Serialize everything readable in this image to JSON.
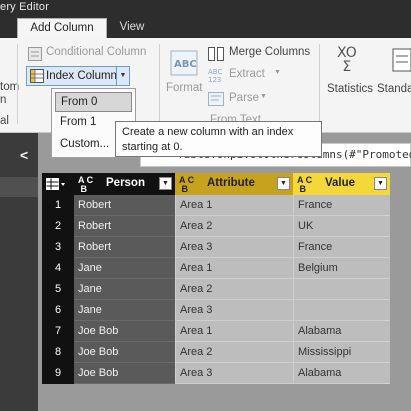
{
  "window": {
    "title": "ery Editor"
  },
  "tabs": [
    {
      "label": "Add Column",
      "active": true
    },
    {
      "label": "View",
      "active": false
    }
  ],
  "ribbon": {
    "custom_label_1": "tom",
    "custom_label_2": "n",
    "general_group": "al",
    "conditional_column": "Conditional Column",
    "index_column": "Index Column",
    "index_column_arrow": "▼",
    "format": "Format",
    "merge_columns": "Merge Columns",
    "extract": "Extract",
    "parse": "Parse",
    "from_text_group": "From Text",
    "statistics": "Statistics",
    "standard": "Standa",
    "sigma_glyph": "XO\nΣ"
  },
  "dropdown": {
    "items": [
      "From 0",
      "From 1",
      "Custom..."
    ],
    "hovered_index": 0
  },
  "tooltip": {
    "text": "Create a new column with an index starting at 0."
  },
  "formula_bar": {
    "text": "Table.Unpivot0therColumns(#\"Promoted"
  },
  "left_panel": {
    "chevron": "<"
  },
  "table": {
    "type_glyph": "A C\n B",
    "columns": [
      {
        "label": "Person",
        "type": "ABC",
        "header_bg": "#111111",
        "header_fg": "#ffffff"
      },
      {
        "label": "Attribute",
        "type": "ABC",
        "header_bg": "#c7a21e",
        "header_fg": "#222222"
      },
      {
        "label": "Value",
        "type": "ABC",
        "header_bg": "#f4d83a",
        "header_fg": "#222222"
      }
    ],
    "filter_glyph": "▼",
    "rows": [
      {
        "index": "1",
        "person": "Robert",
        "attribute": "Area 1",
        "value": "France"
      },
      {
        "index": "2",
        "person": "Robert",
        "attribute": "Area 2",
        "value": "UK"
      },
      {
        "index": "3",
        "person": "Robert",
        "attribute": "Area 3",
        "value": "France"
      },
      {
        "index": "4",
        "person": "Jane",
        "attribute": "Area 1",
        "value": "Belgium"
      },
      {
        "index": "5",
        "person": "Jane",
        "attribute": "Area 2",
        "value": ""
      },
      {
        "index": "6",
        "person": "Jane",
        "attribute": "Area 3",
        "value": ""
      },
      {
        "index": "7",
        "person": "Joe Bob",
        "attribute": "Area 1",
        "value": "Alabama"
      },
      {
        "index": "8",
        "person": "Joe Bob",
        "attribute": "Area 2",
        "value": "Mississippi"
      },
      {
        "index": "9",
        "person": "Joe Bob",
        "attribute": "Area 3",
        "value": "Alabama"
      }
    ]
  }
}
